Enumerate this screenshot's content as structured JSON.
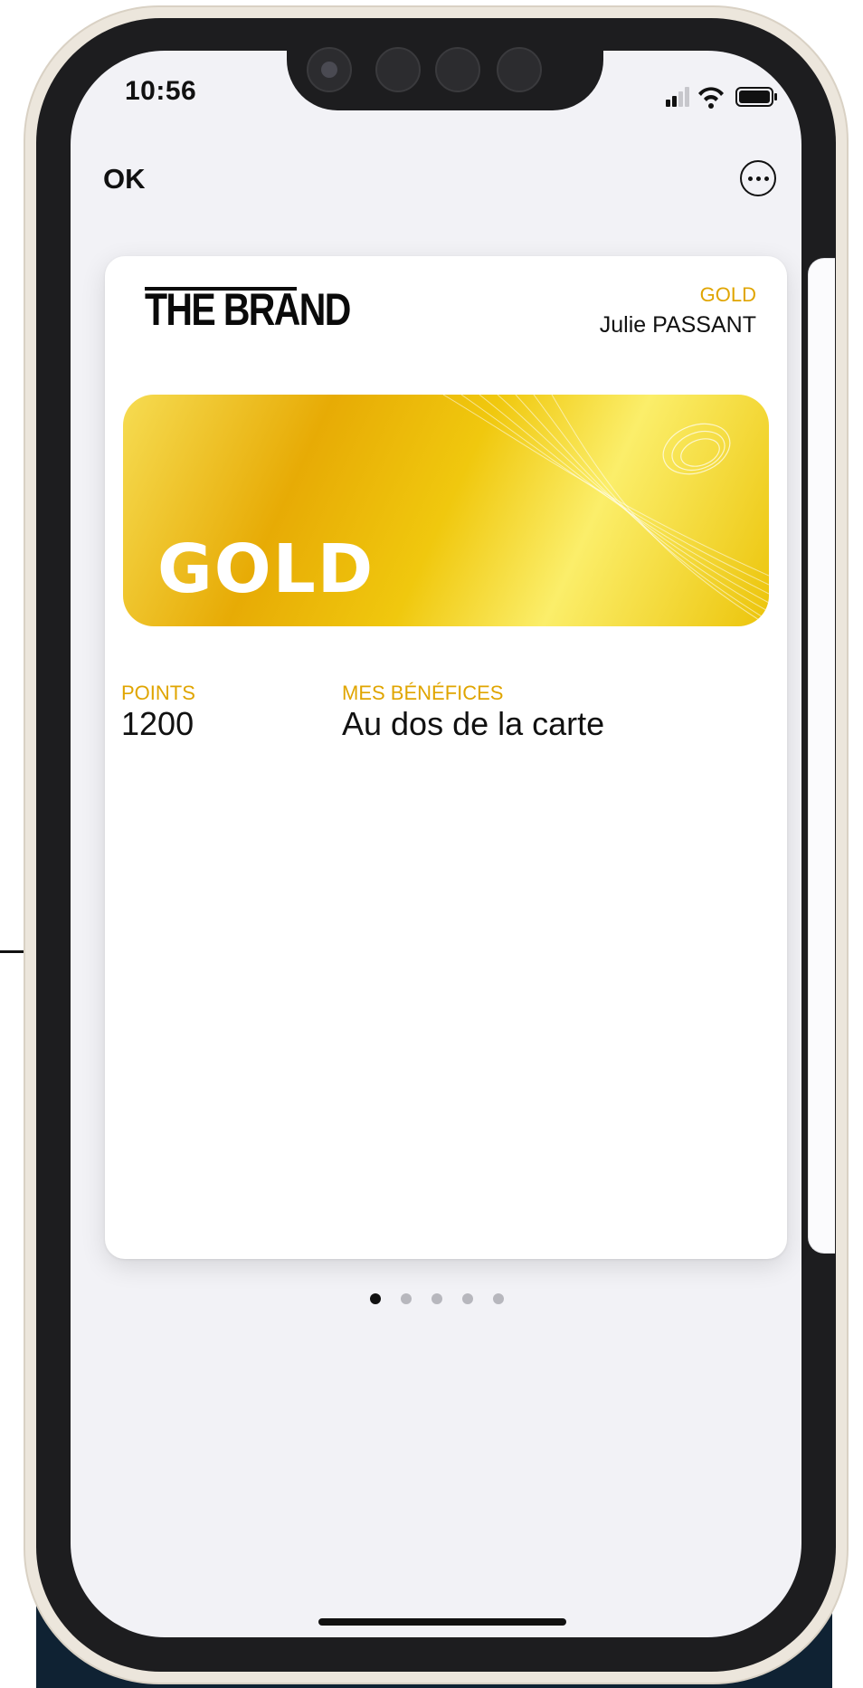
{
  "status_bar": {
    "time": "10:56",
    "icons": [
      "cellular-signal-icon",
      "wifi-icon",
      "battery-icon"
    ]
  },
  "nav": {
    "done_label": "OK",
    "more_icon": "ellipsis-circle-icon"
  },
  "card": {
    "brand_logo_text": "THE BRAND",
    "tier_label": "GOLD",
    "holder_name": "Julie PASSANT",
    "strip_text": "GOLD",
    "fields": [
      {
        "label": "POINTS",
        "value": "1200"
      },
      {
        "label": "MES BÉNÉFICES",
        "value": "Au dos de la carte"
      }
    ]
  },
  "pagination": {
    "count": 5,
    "active_index": 0
  },
  "colors": {
    "accent_gold": "#e0a500",
    "screen_bg": "#f2f2f6",
    "card_bg": "#ffffff",
    "text": "#111111"
  }
}
